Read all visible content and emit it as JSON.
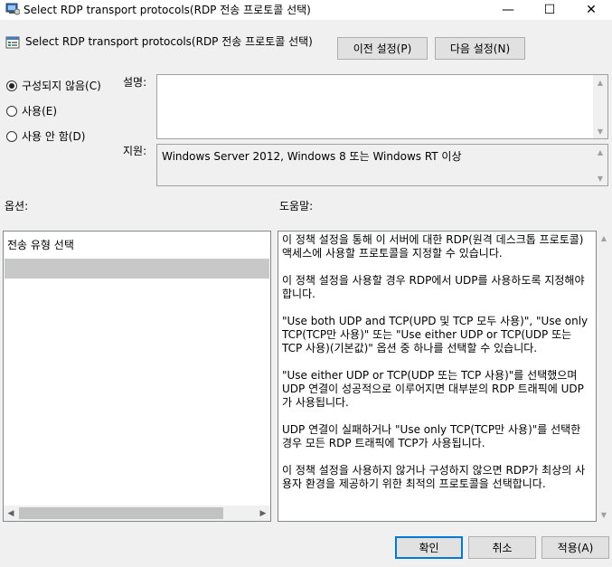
{
  "window": {
    "title": "Select RDP transport protocols(RDP 전송 프로토콜 선택)",
    "min_glyph": "—",
    "max_glyph": "☐",
    "close_glyph": "✕"
  },
  "header": {
    "title": "Select RDP transport protocols(RDP 전송 프로토콜 선택)",
    "prev_label": "이전 설정(P)",
    "next_label": "다음 설정(N)"
  },
  "state": {
    "radios": [
      {
        "label": "구성되지 않음(C)",
        "selected": true
      },
      {
        "label": "사용(E)",
        "selected": false
      },
      {
        "label": "사용 안 함(D)",
        "selected": false
      }
    ]
  },
  "comment": {
    "label": "설명:",
    "value": ""
  },
  "supported": {
    "label": "지원:",
    "value": "Windows Server 2012, Windows 8 또는 Windows RT 이상"
  },
  "options": {
    "label": "옵션:",
    "title": "전송 유형 선택",
    "selected_value": ""
  },
  "help": {
    "label": "도움말:",
    "paragraphs": [
      "이 정책 설정을 통해 이 서버에 대한 RDP(원격 데스크톱 프로토콜) 액세스에 사용할 프로토콜을 지정할 수 있습니다.",
      "이 정책 설정을 사용할 경우 RDP에서 UDP를 사용하도록 지정해야 합니다.",
      "\"Use both UDP and TCP(UPD 및 TCP 모두 사용)\", \"Use only TCP(TCP만 사용)\" 또는 \"Use either UDP or TCP(UDP 또는 TCP 사용)(기본값)\" 옵션 중 하나를 선택할 수 있습니다.",
      "\"Use either UDP or TCP(UDP 또는 TCP 사용)\"를 선택했으며 UDP 연결이 성공적으로 이루어지면 대부분의 RDP 트래픽에 UDP가 사용됩니다.",
      "UDP 연결이 실패하거나 \"Use only TCP(TCP만 사용)\"를 선택한 경우 모든 RDP 트래픽에 TCP가 사용됩니다.",
      "이 정책 설정을 사용하지 않거나 구성하지 않으면 RDP가 최상의 사용자 환경을 제공하기 위한 최적의 프로토콜을 선택합니다."
    ]
  },
  "footer": {
    "ok_label": "확인",
    "cancel_label": "취소",
    "apply_label": "적용(A)"
  },
  "colors": {
    "accent": "#0078d7",
    "window_bg": "#f0f0f0"
  },
  "icons": {
    "title": "policy-window-icon",
    "header": "policy-setting-icon"
  }
}
